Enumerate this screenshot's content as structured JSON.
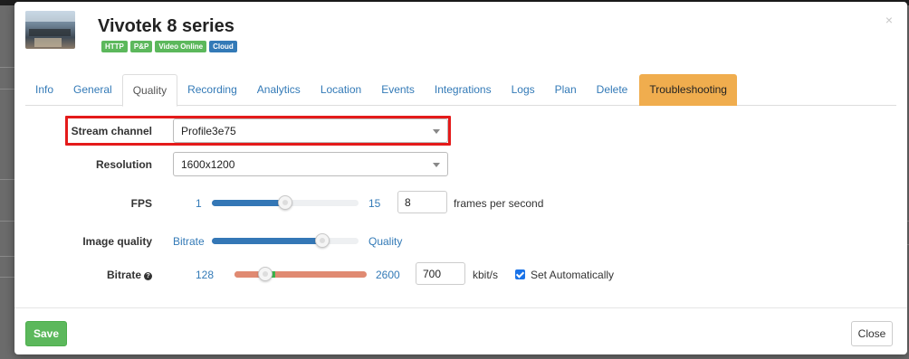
{
  "header": {
    "title": "Vivotek 8 series",
    "badges": [
      {
        "label": "HTTP",
        "color": "#5cb85c"
      },
      {
        "label": "P&P",
        "color": "#5cb85c"
      },
      {
        "label": "Video Online",
        "color": "#5cb85c"
      },
      {
        "label": "Cloud",
        "color": "#337ab7"
      }
    ],
    "close_icon": "×"
  },
  "tabs": [
    {
      "label": "Info"
    },
    {
      "label": "General"
    },
    {
      "label": "Quality",
      "active": true
    },
    {
      "label": "Recording"
    },
    {
      "label": "Analytics"
    },
    {
      "label": "Location"
    },
    {
      "label": "Events"
    },
    {
      "label": "Integrations"
    },
    {
      "label": "Logs"
    },
    {
      "label": "Plan"
    },
    {
      "label": "Delete"
    },
    {
      "label": "Troubleshooting",
      "color": "#f0ad4e"
    }
  ],
  "form": {
    "stream_channel": {
      "label": "Stream channel",
      "value": "Profile3e75"
    },
    "resolution": {
      "label": "Resolution",
      "value": "1600x1200"
    },
    "fps": {
      "label": "FPS",
      "min": "1",
      "max": "15",
      "value": "8",
      "unit": "frames per second",
      "level": 0.5
    },
    "image_quality": {
      "label": "Image quality",
      "left": "Bitrate",
      "right": "Quality",
      "level": 0.75
    },
    "bitrate": {
      "label": "Bitrate",
      "min": "128",
      "max": "2600",
      "value": "700",
      "unit": "kbit/s",
      "auto_label": "Set Automatically",
      "auto_checked": true,
      "level": 0.23
    }
  },
  "footer": {
    "save_label": "Save",
    "close_label": "Close"
  },
  "colors": {
    "highlight": "#e41a1a",
    "accent": "#337ab7",
    "success": "#5cb85c",
    "warning": "#f0ad4e"
  }
}
